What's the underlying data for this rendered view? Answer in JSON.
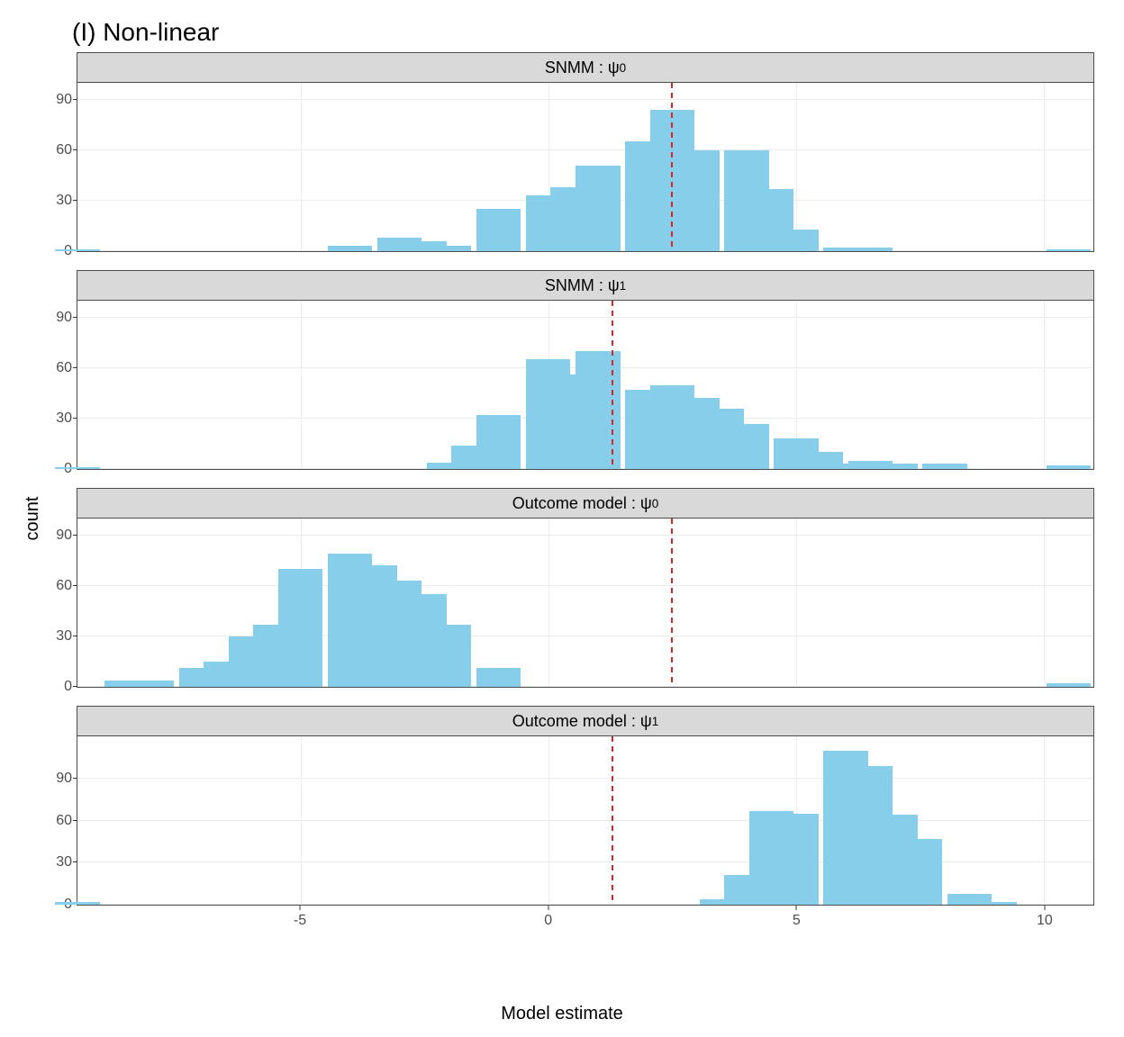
{
  "title": "(I) Non-linear",
  "xlabel": "Model estimate",
  "ylabel": "count",
  "chart_data": {
    "type": "bar",
    "shared_x": {
      "min": -9.5,
      "max": 11,
      "ticks": [
        -5,
        0,
        5,
        10
      ]
    },
    "shared_y": {
      "ticks": [
        0,
        30,
        60,
        90
      ]
    },
    "bar_color": "#87ceeb",
    "vline_color": "#d62728",
    "vline_style": "dashed",
    "bin_width": 1,
    "panels": [
      {
        "strip_label": "SNMM : ψ₀",
        "strip_html": "SNMM : &psi;<span class=\"sub\">0</span>",
        "vline_x": 2.5,
        "y_max": 100,
        "bins": [
          {
            "x": -9.5,
            "count": 1
          },
          {
            "x": -4,
            "count": 3
          },
          {
            "x": -3,
            "count": 8
          },
          {
            "x": -2.5,
            "count": 6
          },
          {
            "x": -2,
            "count": 3
          },
          {
            "x": -1,
            "count": 25
          },
          {
            "x": 0,
            "count": 33
          },
          {
            "x": 0.5,
            "count": 38
          },
          {
            "x": 1,
            "count": 51
          },
          {
            "x": 2,
            "count": 65
          },
          {
            "x": 2.5,
            "count": 84
          },
          {
            "x": 3,
            "count": 60
          },
          {
            "x": 4,
            "count": 60
          },
          {
            "x": 4.5,
            "count": 37
          },
          {
            "x": 5,
            "count": 13
          },
          {
            "x": 6,
            "count": 2
          },
          {
            "x": 6.5,
            "count": 2
          },
          {
            "x": 10.5,
            "count": 1
          }
        ]
      },
      {
        "strip_label": "SNMM : ψ₁",
        "strip_html": "SNMM : &psi;<span class=\"sub\">1</span>",
        "vline_x": 1.3,
        "y_max": 100,
        "bins": [
          {
            "x": -9.5,
            "count": 1
          },
          {
            "x": -2,
            "count": 4
          },
          {
            "x": -1.5,
            "count": 14
          },
          {
            "x": -1,
            "count": 32
          },
          {
            "x": 0,
            "count": 65
          },
          {
            "x": 0.5,
            "count": 56
          },
          {
            "x": 1,
            "count": 70
          },
          {
            "x": 2,
            "count": 47
          },
          {
            "x": 2.5,
            "count": 50
          },
          {
            "x": 3,
            "count": 42
          },
          {
            "x": 3.5,
            "count": 36
          },
          {
            "x": 4,
            "count": 27
          },
          {
            "x": 5,
            "count": 18
          },
          {
            "x": 5.5,
            "count": 10
          },
          {
            "x": 6,
            "count": 3
          },
          {
            "x": 6.5,
            "count": 5
          },
          {
            "x": 7,
            "count": 3
          },
          {
            "x": 8,
            "count": 3
          },
          {
            "x": 10.5,
            "count": 2
          }
        ]
      },
      {
        "strip_label": "Outcome model : ψ₀",
        "strip_html": "Outcome model : &psi;<span class=\"sub\">0</span>",
        "vline_x": 2.5,
        "y_max": 100,
        "bins": [
          {
            "x": -8.5,
            "count": 4
          },
          {
            "x": -8,
            "count": 4
          },
          {
            "x": -7,
            "count": 11
          },
          {
            "x": -6.5,
            "count": 15
          },
          {
            "x": -6,
            "count": 30
          },
          {
            "x": -5.5,
            "count": 37
          },
          {
            "x": -5,
            "count": 70
          },
          {
            "x": -4,
            "count": 79
          },
          {
            "x": -3.5,
            "count": 72
          },
          {
            "x": -3,
            "count": 63
          },
          {
            "x": -2.5,
            "count": 55
          },
          {
            "x": -2,
            "count": 37
          },
          {
            "x": -1,
            "count": 11
          },
          {
            "x": 10.5,
            "count": 2
          }
        ]
      },
      {
        "strip_label": "Outcome model : ψ₁",
        "strip_html": "Outcome model : &psi;<span class=\"sub\">1</span>",
        "vline_x": 1.3,
        "y_max": 120,
        "bins": [
          {
            "x": -9.5,
            "count": 2
          },
          {
            "x": 3.5,
            "count": 4
          },
          {
            "x": 4,
            "count": 21
          },
          {
            "x": 4.5,
            "count": 67
          },
          {
            "x": 5,
            "count": 65
          },
          {
            "x": 6,
            "count": 110
          },
          {
            "x": 6.5,
            "count": 99
          },
          {
            "x": 7,
            "count": 64
          },
          {
            "x": 7.5,
            "count": 47
          },
          {
            "x": 8.5,
            "count": 8
          },
          {
            "x": 9,
            "count": 2
          }
        ]
      }
    ]
  }
}
